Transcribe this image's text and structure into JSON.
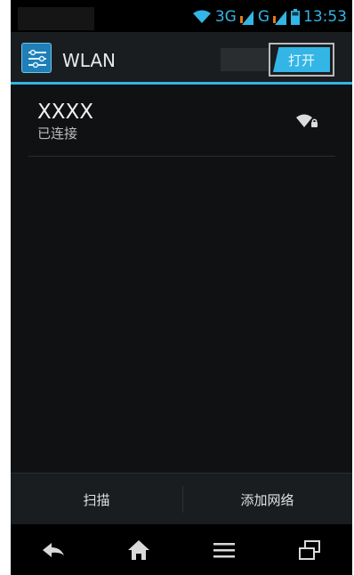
{
  "status_bar": {
    "network_3g": "3G",
    "network_g": "G",
    "time": "13:53"
  },
  "app_bar": {
    "title": "WLAN",
    "toggle_label": "打开",
    "icon": "settings-sliders-icon"
  },
  "wifi_list": [
    {
      "ssid": "XXXX",
      "status": "已连接",
      "signal_icon": "wifi-locked-icon"
    }
  ],
  "actions": {
    "scan": "扫描",
    "add_network": "添加网络"
  },
  "navigation": {
    "back_icon": "back-icon",
    "home_icon": "home-icon",
    "menu_icon": "menu-icon",
    "recents_icon": "recent-apps-icon"
  },
  "colors": {
    "accent": "#33b5e5",
    "background": "#0f1112",
    "app_bar": "#1a1d20"
  }
}
